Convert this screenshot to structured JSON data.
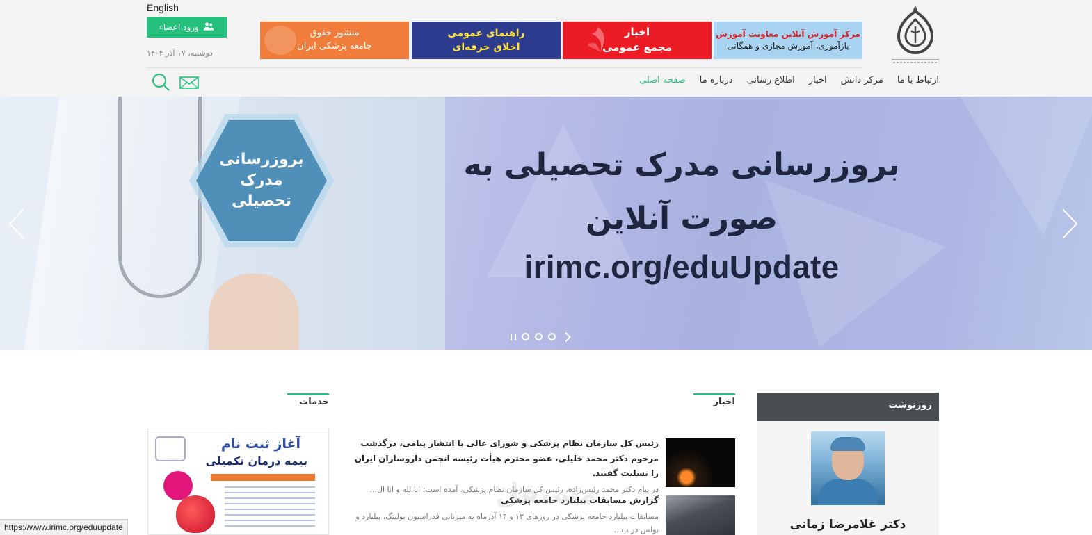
{
  "header": {
    "lang_link": "English",
    "login_label": "ورود اعضاء",
    "date": "دوشنبه، ۱۷ آذر ۱۴۰۴",
    "banners": [
      {
        "line1": "منشور حقوق",
        "line2": "جامعه پزشکی ایران"
      },
      {
        "line1": "راهنمای عمومی",
        "line2": "اخلاق حرفه‌ای"
      },
      {
        "line1": "اخبار",
        "line2": "مجمع عمومی"
      },
      {
        "line1": "مرکز آموزش آنلاین معاونت آموزش",
        "line2": "بازآموزی، آموزش مجازی و همگانی"
      }
    ],
    "nav": [
      "صفحه اصلی",
      "درباره ما",
      "اطلاع رسانی",
      "اخبار",
      "مرکز دانش",
      "ارتباط با ما"
    ],
    "nav_active_index": 0
  },
  "slider": {
    "hex_lines": [
      "بروزرسانی",
      "مدرک",
      "تحصیلی"
    ],
    "title_line1": "بروزرسانی مدرک تحصیلی به",
    "title_line2": "صورت آنلاین",
    "url": "irimc.org/eduUpdate",
    "dot_count": 3
  },
  "sections": {
    "services_title": "خدمات",
    "news_title": "اخبار",
    "rooznevesht_title": "روزنوشت"
  },
  "services_banner": {
    "title1": "آغاز ثبت نام",
    "title2": "بیمه درمان تکمیلی"
  },
  "news": [
    {
      "title": "رئیس کل سازمان نظام پزشکی و شورای عالی با انتشار پیامی، درگذشت مرحوم دکتر محمد خلیلی، عضو محترم هیأت رئیسه انجمن داروسازان ایران را تسلیت گفتند.",
      "summary": "در پیام دکتر محمد رئیس‌زاده، رئیس کل سازمان نظام پزشکی، آمده است:   انا لله و انا ال..."
    },
    {
      "title": "گزارش مسابقات بیلیارد جامعه پزشکی",
      "summary": "مسابقات بیلیارد جامعه پزشکی در روزهای ۱۳ و ۱۴ آذرماه به میزبانی فدراسیون بولینگ، بیلیارد و بولس در ب..."
    }
  ],
  "watermark": "مستقل",
  "rooznevesht": {
    "author": "دکتر غلامرضا زمانی"
  },
  "status_bar_url": "https://www.irimc.org/eduupdate",
  "colors": {
    "accent": "#24c07c",
    "header_bg": "#f4f4f4",
    "banner_orange": "#f07d3b",
    "banner_navy": "#2d3c8e",
    "banner_red": "#ec1c24",
    "banner_lightblue": "#a8d4f2",
    "rooznevesht_head": "#4a4d52"
  }
}
